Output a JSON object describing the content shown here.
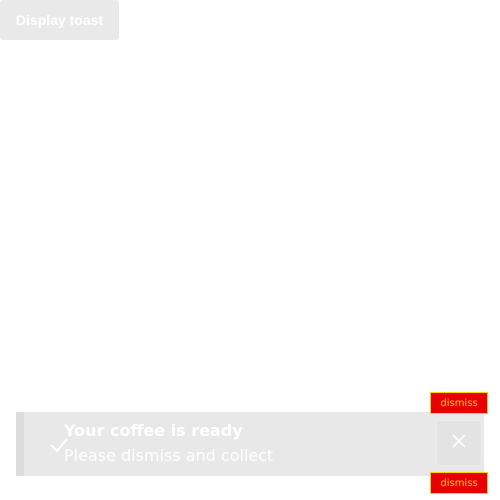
{
  "display_button": {
    "label": "Display toast"
  },
  "toast": {
    "title": "Your coffee is ready",
    "message": "Please dismiss and collect",
    "dismiss_tooltip": "dismiss",
    "icons": {
      "status": "check-icon",
      "dismiss": "close-icon"
    }
  },
  "colors": {
    "page_background": "#ffffff",
    "toast_background": "#e8e8e8",
    "tooltip_background": "#e80000",
    "tooltip_text": "#ffd200"
  }
}
